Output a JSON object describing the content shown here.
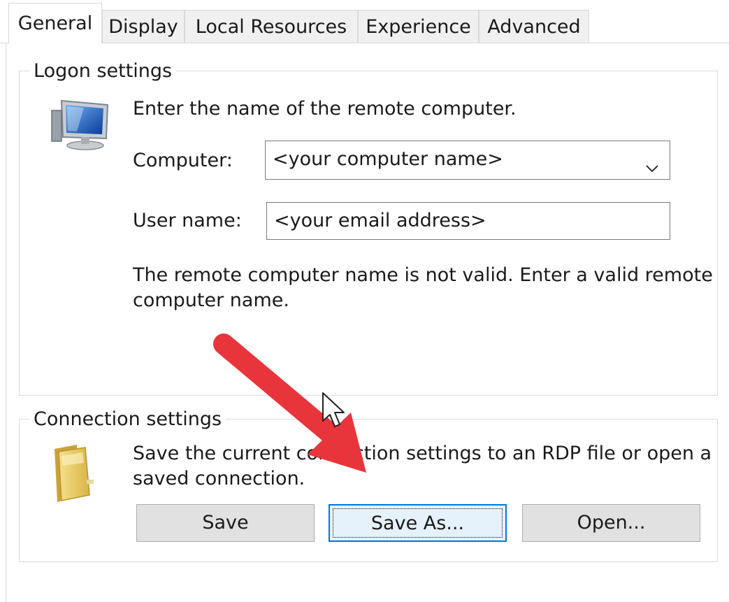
{
  "tabs": [
    {
      "label": "General",
      "active": true
    },
    {
      "label": "Display",
      "active": false
    },
    {
      "label": "Local Resources",
      "active": false
    },
    {
      "label": "Experience",
      "active": false
    },
    {
      "label": "Advanced",
      "active": false
    }
  ],
  "logon": {
    "legend": "Logon settings",
    "intro": "Enter the name of the remote computer.",
    "computer_label": "Computer:",
    "computer_value": "<your computer name>",
    "username_label": "User name:",
    "username_value": "<your email address>",
    "error_line1": "The remote computer name is not valid. Enter a valid remote",
    "error_line2": "computer name."
  },
  "connection": {
    "legend": "Connection settings",
    "desc_line1": "Save the current connection settings to an RDP file or open a",
    "desc_line2": "saved connection.",
    "buttons": {
      "save": "Save",
      "save_as": "Save As...",
      "open": "Open..."
    }
  },
  "colors": {
    "accent": "#0078d7",
    "annotation_arrow": "#e8353b"
  },
  "icons": {
    "computer": "monitor-icon",
    "folder": "folder-icon",
    "dropdown": "chevron-down-icon",
    "pointer": "mouse-cursor-icon",
    "annotation": "red-arrow-annotation"
  }
}
